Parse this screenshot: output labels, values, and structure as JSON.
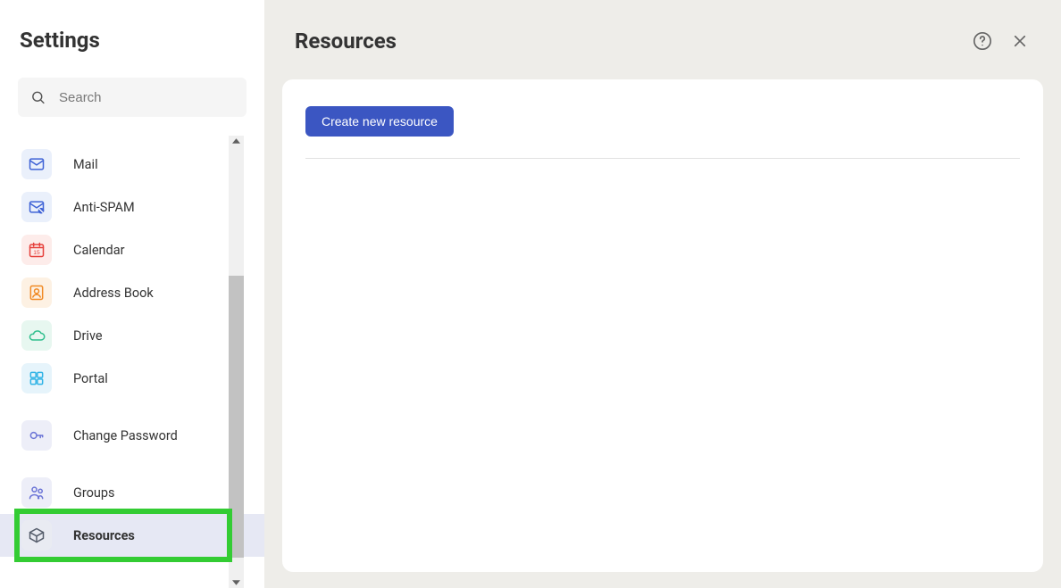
{
  "sidebar": {
    "title": "Settings",
    "search_placeholder": "Search",
    "items": [
      {
        "id": "mail",
        "label": "Mail",
        "icon": "mail-icon",
        "icon_color": "#3f63d6",
        "icon_bg": "#eaf0fb"
      },
      {
        "id": "antispam",
        "label": "Anti-SPAM",
        "icon": "antispam-icon",
        "icon_color": "#3f63d6",
        "icon_bg": "#eaf0fb"
      },
      {
        "id": "calendar",
        "label": "Calendar",
        "icon": "calendar-icon",
        "icon_color": "#e6413c",
        "icon_bg": "#fdecea"
      },
      {
        "id": "addressbook",
        "label": "Address Book",
        "icon": "contacts-icon",
        "icon_color": "#f08a24",
        "icon_bg": "#fdf1e3"
      },
      {
        "id": "drive",
        "label": "Drive",
        "icon": "cloud-icon",
        "icon_color": "#2fbf8d",
        "icon_bg": "#e7f7f0"
      },
      {
        "id": "portal",
        "label": "Portal",
        "icon": "grid-icon",
        "icon_color": "#2fb3e6",
        "icon_bg": "#e6f4fb"
      },
      {
        "gap": true
      },
      {
        "id": "changepw",
        "label": "Change Password",
        "icon": "key-icon",
        "icon_color": "#6b74d6",
        "icon_bg": "#edeef8"
      },
      {
        "gap": true
      },
      {
        "id": "groups",
        "label": "Groups",
        "icon": "people-icon",
        "icon_color": "#6b74d6",
        "icon_bg": "#edeef8"
      },
      {
        "id": "resources",
        "label": "Resources",
        "icon": "cube-icon",
        "icon_color": "#555d6b",
        "icon_bg": "#e9ebf2",
        "selected": true
      }
    ]
  },
  "main": {
    "title": "Resources",
    "create_button_label": "Create new resource"
  },
  "colors": {
    "accent": "#3b56c2",
    "highlight": "#33cc33",
    "main_bg": "#eeede9"
  }
}
